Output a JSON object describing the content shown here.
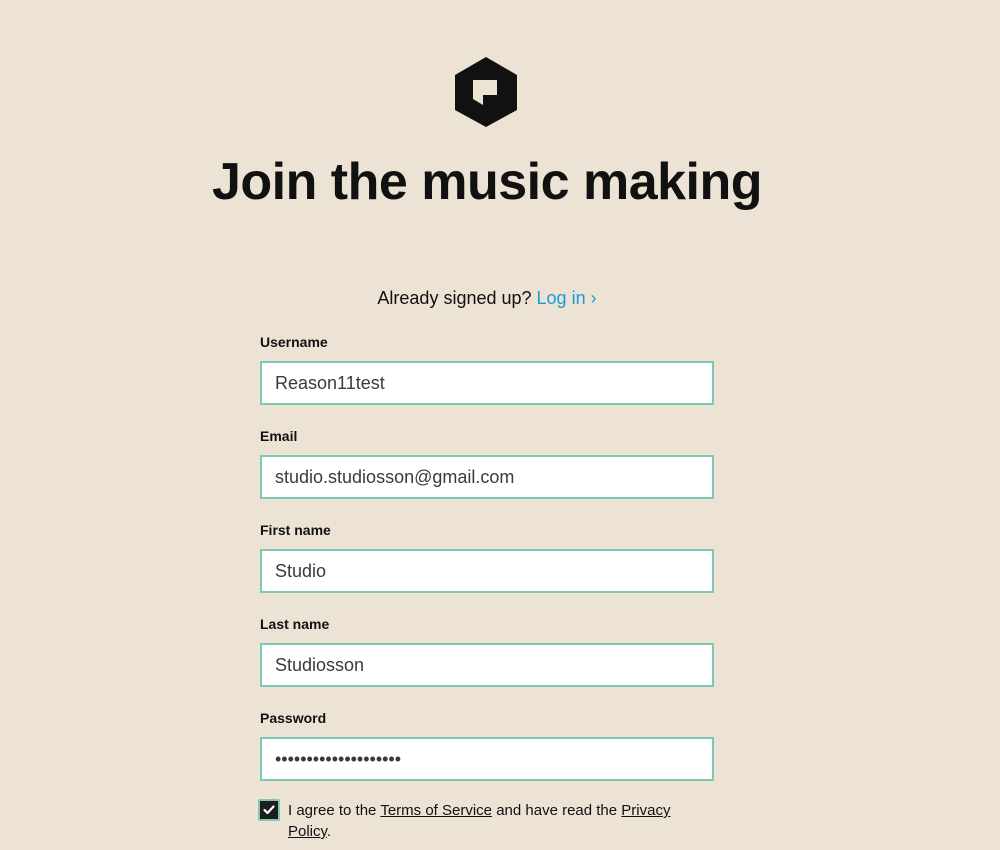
{
  "logo": {
    "icon": "reason-cube-logo",
    "color": "#111111"
  },
  "heading": "Join the music making",
  "signin": {
    "prompt": "Already signed up?",
    "link_label": "Log in",
    "link_chevron": "›",
    "link_color": "#1a9bd7"
  },
  "form": {
    "username": {
      "label": "Username",
      "value": "Reason11test"
    },
    "email": {
      "label": "Email",
      "value": "studio.studiosson@gmail.com"
    },
    "first_name": {
      "label": "First name",
      "value": "Studio"
    },
    "last_name": {
      "label": "Last name",
      "value": "Studiosson"
    },
    "password": {
      "label": "Password",
      "value": "••••••••••••••••••••"
    }
  },
  "agreement": {
    "checked": true,
    "text_before": "I agree to the",
    "terms_label": "Terms of Service",
    "text_middle": "and have read the",
    "privacy_label": "Privacy Policy",
    "text_after": "."
  },
  "colors": {
    "background": "#ede3d5",
    "input_border": "#7ec9b3",
    "text": "#111111"
  }
}
